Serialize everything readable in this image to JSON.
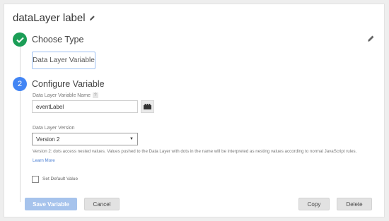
{
  "header": {
    "title": "dataLayer label",
    "title_edit_icon": "pencil-icon"
  },
  "step1": {
    "status_icon": "check-icon",
    "title": "Choose Type",
    "selected_type": "Data Layer Variable",
    "edit_icon": "pencil-icon"
  },
  "step2": {
    "number": "2",
    "title": "Configure Variable",
    "name_field": {
      "label": "Data Layer Variable Name",
      "help": "?",
      "value": "eventLabel",
      "picker_icon": "variable-lego-icon"
    },
    "version_field": {
      "label": "Data Layer Version",
      "selected": "Version 2",
      "help_text": "Version 2: dots access nested values. Values pushed to the Data Layer with dots in the name will be interpreted as nesting values according to normal JavaScript rules.",
      "learn_more": "Learn More"
    },
    "default_value": {
      "label": "Set Default Value",
      "checked": false
    }
  },
  "actions": {
    "save": "Save Variable",
    "cancel": "Cancel",
    "copy": "Copy",
    "delete": "Delete"
  },
  "colors": {
    "check": "#1b9e57",
    "step_badge": "#4285f4",
    "link": "#4a7fd4",
    "primary_button": "#a6c3ec"
  }
}
